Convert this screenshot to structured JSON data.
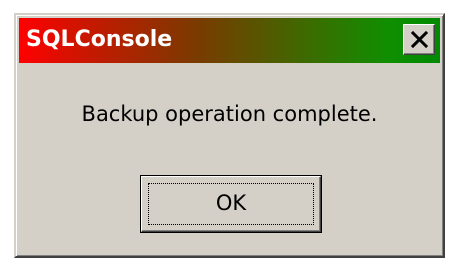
{
  "dialog": {
    "title": "SQLConsole",
    "message": "Backup operation complete.",
    "ok_label": "OK",
    "close_icon": "close-icon"
  },
  "colors": {
    "title_gradient_start": "#ff0000",
    "title_gradient_end": "#008a00",
    "title_text": "#ffffff",
    "dialog_face": "#d4d0c8"
  }
}
